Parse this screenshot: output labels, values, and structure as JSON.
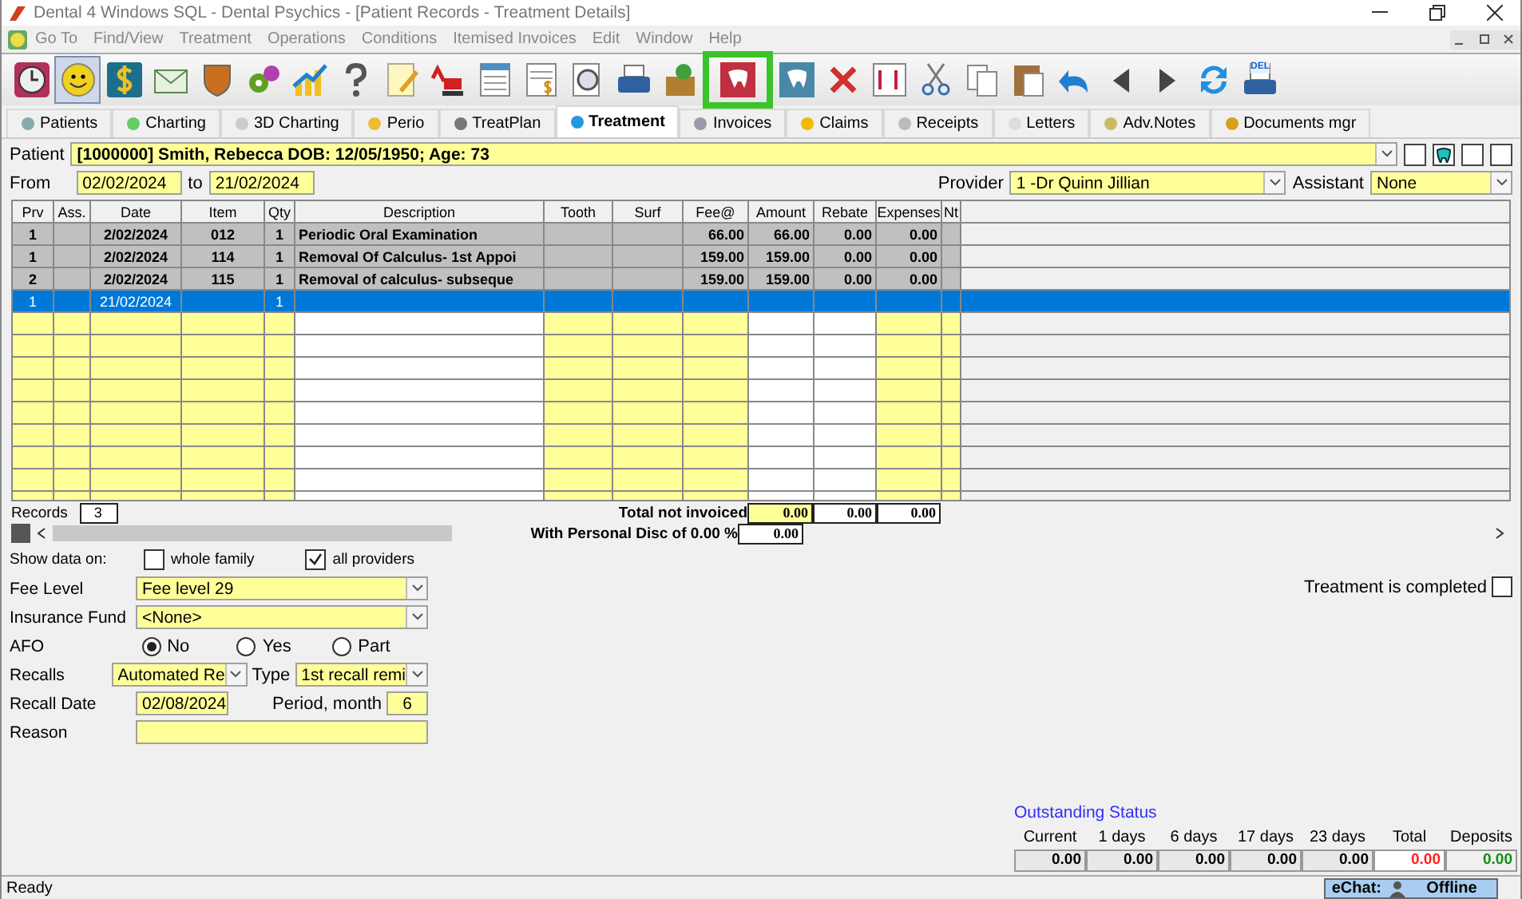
{
  "window": {
    "title": "Dental 4 Windows SQL - Dental Psychics - [Patient Records - Treatment Details]"
  },
  "menu": [
    {
      "label": "Go To",
      "disabled": true
    },
    {
      "label": "Find/View",
      "disabled": true
    },
    {
      "label": "Treatment",
      "disabled": true
    },
    {
      "label": "Operations",
      "disabled": true
    },
    {
      "label": "Conditions",
      "disabled": true
    },
    {
      "label": "Itemised Invoices",
      "disabled": true
    },
    {
      "label": "Edit",
      "disabled": true
    },
    {
      "label": "Window",
      "disabled": true
    },
    {
      "label": "Help",
      "disabled": true
    }
  ],
  "toolbar": {
    "print_badge": "DEL"
  },
  "tabs": [
    {
      "label": "Patients",
      "selected": false
    },
    {
      "label": "Charting",
      "selected": false
    },
    {
      "label": "3D Charting",
      "selected": false
    },
    {
      "label": "Perio",
      "selected": false
    },
    {
      "label": "TreatPlan",
      "selected": false
    },
    {
      "label": "Treatment",
      "selected": true
    },
    {
      "label": "Invoices",
      "selected": false
    },
    {
      "label": "Claims",
      "selected": false
    },
    {
      "label": "Receipts",
      "selected": false
    },
    {
      "label": "Letters",
      "selected": false
    },
    {
      "label": "Adv.Notes",
      "selected": false
    },
    {
      "label": "Documents mgr",
      "selected": false
    }
  ],
  "patient": {
    "label": "Patient",
    "value": "[1000000] Smith, Rebecca DOB: 12/05/1950; Age: 73"
  },
  "date_range": {
    "from_label": "From",
    "from": "02/02/2024",
    "to_label": "to",
    "to": "21/02/2024"
  },
  "provider": {
    "label": "Provider",
    "value": "1 -Dr Quinn Jillian"
  },
  "assistant": {
    "label": "Assistant",
    "value": "None"
  },
  "table": {
    "columns": [
      "Prv",
      "Ass.",
      "Date",
      "Item",
      "Qty",
      "Description",
      "Tooth",
      "Surf",
      "Fee@",
      "Amount",
      "Rebate",
      "Expenses",
      "Nt"
    ],
    "rows": [
      {
        "selected": false,
        "cells": [
          "1",
          "",
          "2/02/2024",
          "012",
          "1",
          "Periodic Oral Examination",
          "",
          "",
          "66.00",
          "66.00",
          "0.00",
          "0.00",
          ""
        ]
      },
      {
        "selected": false,
        "cells": [
          "1",
          "",
          "2/02/2024",
          "114",
          "1",
          "Removal Of Calculus- 1st Appoi",
          "",
          "",
          "159.00",
          "159.00",
          "0.00",
          "0.00",
          ""
        ]
      },
      {
        "selected": false,
        "cells": [
          "2",
          "",
          "2/02/2024",
          "115",
          "1",
          "Removal of calculus- subseque",
          "",
          "",
          "159.00",
          "159.00",
          "0.00",
          "0.00",
          ""
        ]
      },
      {
        "selected": true,
        "cells": [
          "1",
          "",
          "21/02/2024",
          "",
          "1",
          "",
          "",
          "",
          "",
          "",
          "",
          "",
          ""
        ]
      }
    ]
  },
  "records": {
    "label": "Records",
    "value": "3"
  },
  "totals": {
    "not_invoiced_label": "Total not invoiced",
    "not_invoiced": [
      "0.00",
      "0.00",
      "0.00"
    ],
    "disc_label": "With Personal Disc of 0.00 %",
    "disc_value": "0.00"
  },
  "show_data": {
    "label": "Show data on:",
    "options": [
      {
        "label": "whole family",
        "checked": false
      },
      {
        "label": "all providers",
        "checked": true
      }
    ]
  },
  "fee_level": {
    "label": "Fee Level",
    "value": "Fee level 29"
  },
  "insurance_fund": {
    "label": "Insurance Fund",
    "value": "<None>"
  },
  "afo": {
    "label": "AFO",
    "options": [
      {
        "label": "No",
        "selected": true
      },
      {
        "label": "Yes",
        "selected": false
      },
      {
        "label": "Part",
        "selected": false
      }
    ]
  },
  "recalls": {
    "label": "Recalls",
    "value": "Automated Re",
    "type_label": "Type",
    "type_value": "1st recall remi"
  },
  "recall_date": {
    "label": "Recall Date",
    "value": "02/08/2024",
    "period_label": "Period, month",
    "period": "6"
  },
  "reason": {
    "label": "Reason"
  },
  "treatment_completed": {
    "label": "Treatment is completed",
    "checked": false
  },
  "outstanding": {
    "title": "Outstanding Status",
    "columns": [
      {
        "label": "Current",
        "value": "0.00",
        "kind": "plain"
      },
      {
        "label": "1 days",
        "value": "0.00",
        "kind": "plain"
      },
      {
        "label": "6 days",
        "value": "0.00",
        "kind": "plain"
      },
      {
        "label": "17 days",
        "value": "0.00",
        "kind": "plain"
      },
      {
        "label": "23 days",
        "value": "0.00",
        "kind": "plain"
      },
      {
        "label": "Total",
        "value": "0.00",
        "kind": "total"
      },
      {
        "label": "Deposits",
        "value": "0.00",
        "kind": "deposit"
      }
    ]
  },
  "status_bar": {
    "text": "Ready",
    "chat_label": "eChat:",
    "chat_status": "Offline"
  }
}
